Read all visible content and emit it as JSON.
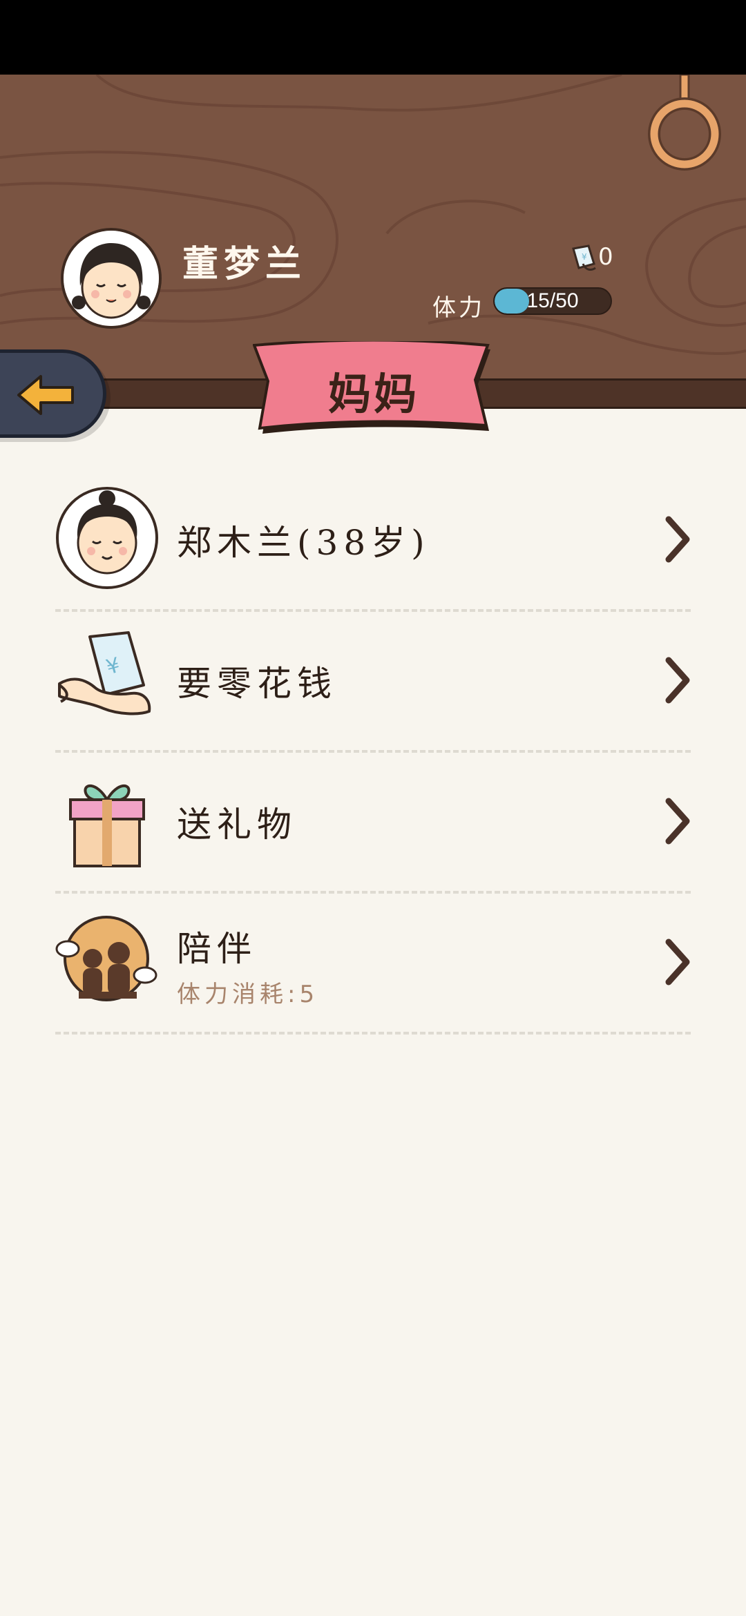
{
  "player": {
    "name": "董梦兰",
    "money": "0",
    "stamina_label": "体力",
    "stamina_text": "15/50",
    "stamina_fraction": 0.3
  },
  "page": {
    "title": "妈妈"
  },
  "menu": {
    "items": [
      {
        "label": "郑木兰(38岁)",
        "icon": "mother-avatar-icon"
      },
      {
        "label": "要零花钱",
        "icon": "money-hand-icon"
      },
      {
        "label": "送礼物",
        "icon": "gift-box-icon"
      },
      {
        "label": "陪伴",
        "sub": "体力消耗:5",
        "icon": "companion-icon"
      }
    ]
  },
  "colors": {
    "header_wood": "#7a5442",
    "banner_pink": "#f07d8e",
    "stamina_fill": "#5cb7d4",
    "back_button": "#3d4457",
    "arrow_yellow": "#f3b23b",
    "background": "#f8f5ee"
  }
}
